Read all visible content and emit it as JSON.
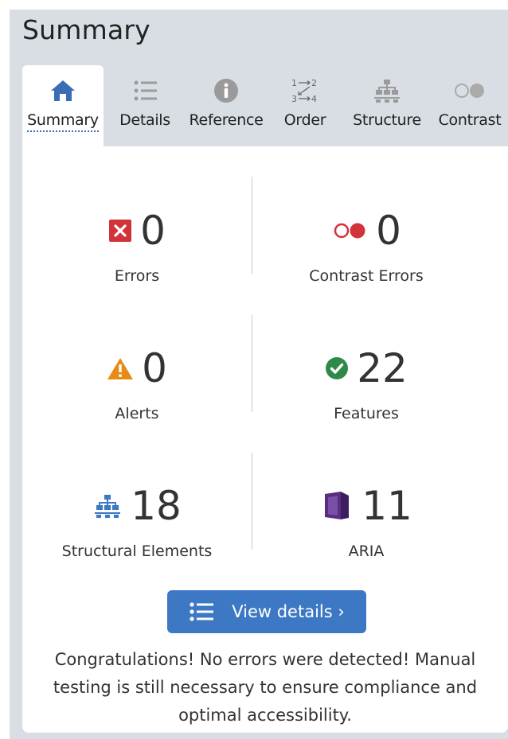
{
  "header": {
    "title": "Summary"
  },
  "tabs": [
    {
      "label": "Summary",
      "icon": "home-icon",
      "active": true
    },
    {
      "label": "Details",
      "icon": "list-icon",
      "active": false
    },
    {
      "label": "Reference",
      "icon": "info-icon",
      "active": false
    },
    {
      "label": "Order",
      "icon": "order-icon",
      "active": false
    },
    {
      "label": "Structure",
      "icon": "structure-icon",
      "active": false
    },
    {
      "label": "Contrast",
      "icon": "contrast-icon",
      "active": false
    }
  ],
  "stats": {
    "errors": {
      "value": "0",
      "label": "Errors",
      "icon": "error-icon"
    },
    "contrast_errors": {
      "value": "0",
      "label": "Contrast Errors",
      "icon": "contrast-error-icon"
    },
    "alerts": {
      "value": "0",
      "label": "Alerts",
      "icon": "alert-icon"
    },
    "features": {
      "value": "22",
      "label": "Features",
      "icon": "check-circle-icon"
    },
    "structural": {
      "value": "18",
      "label": "Structural Elements",
      "icon": "structure-icon"
    },
    "aria": {
      "value": "11",
      "label": "ARIA",
      "icon": "aria-cube-icon"
    }
  },
  "button": {
    "label": "View details ›",
    "icon": "list-icon"
  },
  "message": "Congratulations! No errors were detected! Manual testing is still necessary to ensure compliance and optimal accessibility.",
  "colors": {
    "accent": "#3d78c4",
    "error": "#d0343a",
    "alert": "#e78a17",
    "feature": "#2f8a4a",
    "aria": "#5a2d82",
    "panel": "#d9dee5"
  }
}
